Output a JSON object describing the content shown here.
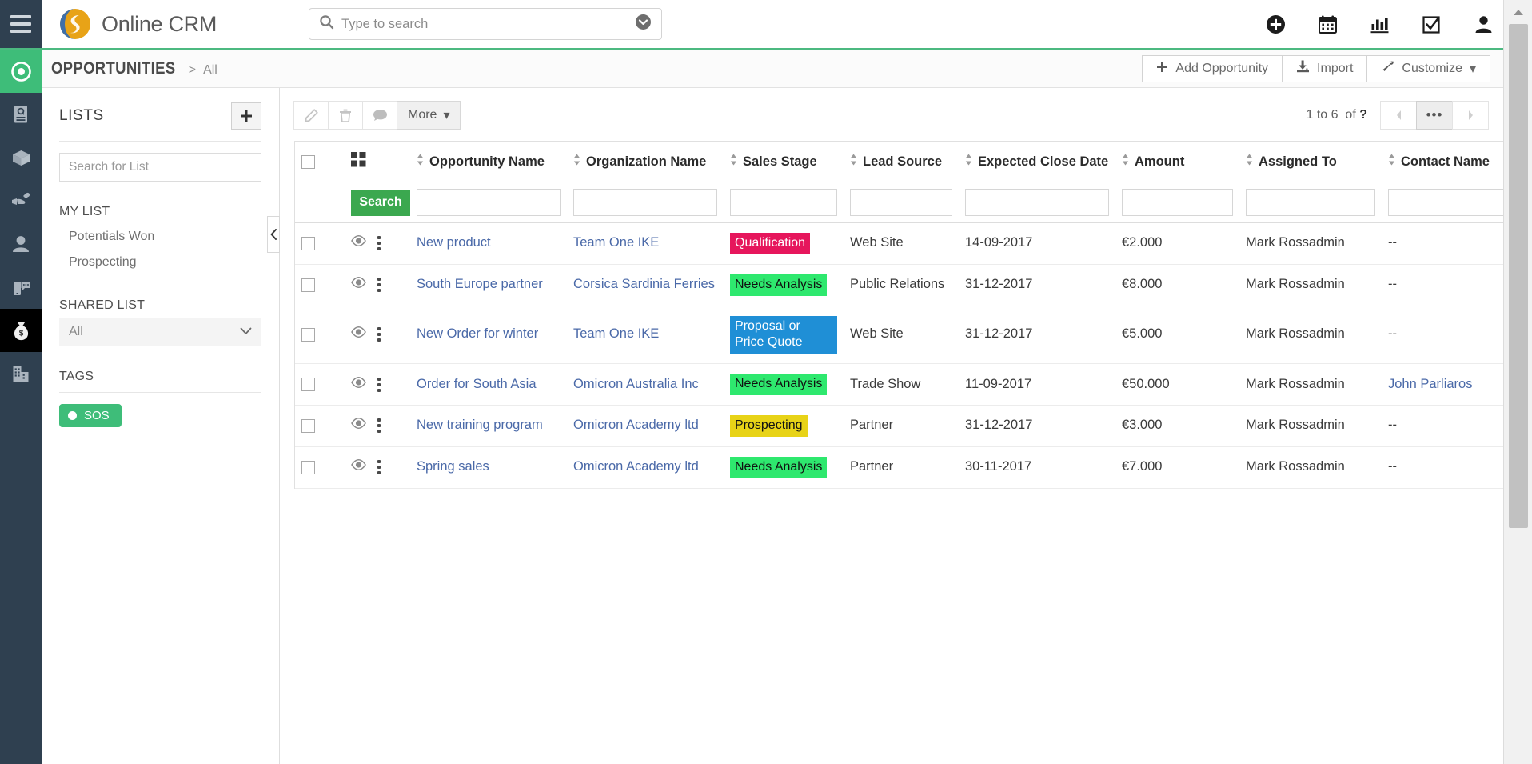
{
  "header": {
    "menu_icon": "hamburger-icon",
    "brand": "Online CRM",
    "logo_icon": "crm-logo-icon",
    "search": {
      "placeholder": "Type to search",
      "value": "",
      "icon": "search-icon",
      "dropdown_icon": "chevron-down-circle-icon"
    },
    "icons": [
      {
        "name": "add-circle-icon",
        "label": "Quick Create"
      },
      {
        "name": "calendar-icon",
        "label": "Calendar"
      },
      {
        "name": "bar-chart-icon",
        "label": "Reports"
      },
      {
        "name": "checkbox-task-icon",
        "label": "Tasks"
      },
      {
        "name": "user-profile-icon",
        "label": "User"
      }
    ]
  },
  "rail": {
    "items": [
      {
        "name": "sidebar-item-target",
        "icon": "target-icon",
        "state": "active-green"
      },
      {
        "name": "sidebar-item-documents",
        "icon": "document-search-icon",
        "state": "normal"
      },
      {
        "name": "sidebar-item-products",
        "icon": "open-box-icon",
        "state": "normal"
      },
      {
        "name": "sidebar-item-services",
        "icon": "handshake-wrench-icon",
        "state": "normal"
      },
      {
        "name": "sidebar-item-contacts",
        "icon": "person-icon",
        "state": "normal"
      },
      {
        "name": "sidebar-item-sms",
        "icon": "mobile-chat-icon",
        "state": "normal"
      },
      {
        "name": "sidebar-item-opportunities",
        "icon": "money-bag-icon",
        "state": "active-dark"
      },
      {
        "name": "sidebar-item-organizations",
        "icon": "building-icon",
        "state": "normal"
      }
    ]
  },
  "subheader": {
    "breadcrumb_main": "OPPORTUNITIES",
    "breadcrumb_sep": ">",
    "breadcrumb_sub": "All",
    "actions": [
      {
        "label": "Add Opportunity",
        "icon": "plus-icon",
        "name": "add-opportunity-button"
      },
      {
        "label": "Import",
        "icon": "import-icon",
        "name": "import-button"
      },
      {
        "label": "Customize",
        "icon": "wrench-icon",
        "name": "customize-button",
        "caret": "▾"
      }
    ]
  },
  "lists_panel": {
    "title": "LISTS",
    "add_icon": "plus-icon",
    "search_placeholder": "Search for List",
    "search_value": "",
    "my_list_title": "MY LIST",
    "my_list_items": [
      "Potentials Won",
      "Prospecting"
    ],
    "shared_list_title": "SHARED LIST",
    "shared_list_value": "All",
    "shared_list_caret": "chevron-down-icon",
    "tags_title": "TAGS",
    "tags": [
      {
        "label": "SOS",
        "color": "#3ebd79"
      }
    ],
    "collapse_handle": "‹"
  },
  "toolbar": {
    "edit_icon": "pencil-icon",
    "delete_icon": "trash-icon",
    "comment_icon": "comment-icon",
    "more_label": "More",
    "more_caret": "▾"
  },
  "pagination": {
    "range_prefix": "1 to 6",
    "of_label": "of",
    "total": "?",
    "prev_icon": "chevron-left-icon",
    "pages_label": "•••",
    "next_icon": "chevron-right-icon"
  },
  "table": {
    "select_all_checkbox": false,
    "column_picker_icon": "grid-icon",
    "columns": [
      {
        "key": "opportunity_name",
        "label": "Opportunity Name",
        "sortable": true
      },
      {
        "key": "organization_name",
        "label": "Organization Name",
        "sortable": true
      },
      {
        "key": "sales_stage",
        "label": "Sales Stage",
        "sortable": true
      },
      {
        "key": "lead_source",
        "label": "Lead Source",
        "sortable": true
      },
      {
        "key": "expected_close_date",
        "label": "Expected Close Date",
        "sortable": true
      },
      {
        "key": "amount",
        "label": "Amount",
        "sortable": true
      },
      {
        "key": "assigned_to",
        "label": "Assigned To",
        "sortable": true
      },
      {
        "key": "contact_name",
        "label": "Contact Name",
        "sortable": true
      }
    ],
    "search_row": {
      "button_label": "Search",
      "filters": {
        "opportunity_name": "",
        "organization_name": "",
        "sales_stage": "",
        "lead_source": "",
        "expected_close_date": "",
        "amount": "",
        "assigned_to": "",
        "contact_name": ""
      }
    },
    "stage_colors": {
      "Qualification": "#e6165c",
      "Needs Analysis": "#2ee86e",
      "Proposal or Price Quote": "#1f8fd6",
      "Prospecting": "#e8d317"
    },
    "stage_text_light": [
      "Qualification",
      "Proposal or Price Quote"
    ],
    "rows": [
      {
        "checked": false,
        "opportunity_name": "New product",
        "organization_name": "Team One IKE",
        "sales_stage": "Qualification",
        "lead_source": "Web Site",
        "expected_close_date": "14-09-2017",
        "amount": "€2.000",
        "assigned_to": "Mark Rossadmin",
        "contact_name": "--",
        "contact_is_link": false
      },
      {
        "checked": false,
        "opportunity_name": "South Europe partner",
        "organization_name": "Corsica Sardinia Ferries",
        "sales_stage": "Needs Analysis",
        "lead_source": "Public Relations",
        "expected_close_date": "31-12-2017",
        "amount": "€8.000",
        "assigned_to": "Mark Rossadmin",
        "contact_name": "--",
        "contact_is_link": false
      },
      {
        "checked": false,
        "opportunity_name": "New Order for winter",
        "organization_name": "Team One IKE",
        "sales_stage": "Proposal or Price Quote",
        "lead_source": "Web Site",
        "expected_close_date": "31-12-2017",
        "amount": "€5.000",
        "assigned_to": "Mark Rossadmin",
        "contact_name": "--",
        "contact_is_link": false
      },
      {
        "checked": false,
        "opportunity_name": "Order for South Asia",
        "organization_name": "Omicron Australia Inc",
        "sales_stage": "Needs Analysis",
        "lead_source": "Trade Show",
        "expected_close_date": "11-09-2017",
        "amount": "€50.000",
        "assigned_to": "Mark Rossadmin",
        "contact_name": "John Parliaros",
        "contact_is_link": true
      },
      {
        "checked": false,
        "opportunity_name": "New training program",
        "organization_name": "Omicron Academy ltd",
        "sales_stage": "Prospecting",
        "lead_source": "Partner",
        "expected_close_date": "31-12-2017",
        "amount": "€3.000",
        "assigned_to": "Mark Rossadmin",
        "contact_name": "--",
        "contact_is_link": false
      },
      {
        "checked": false,
        "opportunity_name": "Spring sales",
        "organization_name": "Omicron Academy ltd",
        "sales_stage": "Needs Analysis",
        "lead_source": "Partner",
        "expected_close_date": "30-11-2017",
        "amount": "€7.000",
        "assigned_to": "Mark Rossadmin",
        "contact_name": "--",
        "contact_is_link": false
      }
    ],
    "row_icons": {
      "view": "eye-icon",
      "menu": "vertical-dots-icon"
    }
  },
  "theme": {
    "accent_green": "#3ebd79",
    "rail_dark": "#2f4050",
    "link_blue": "#4a69a8",
    "search_green": "#3ba84f"
  }
}
